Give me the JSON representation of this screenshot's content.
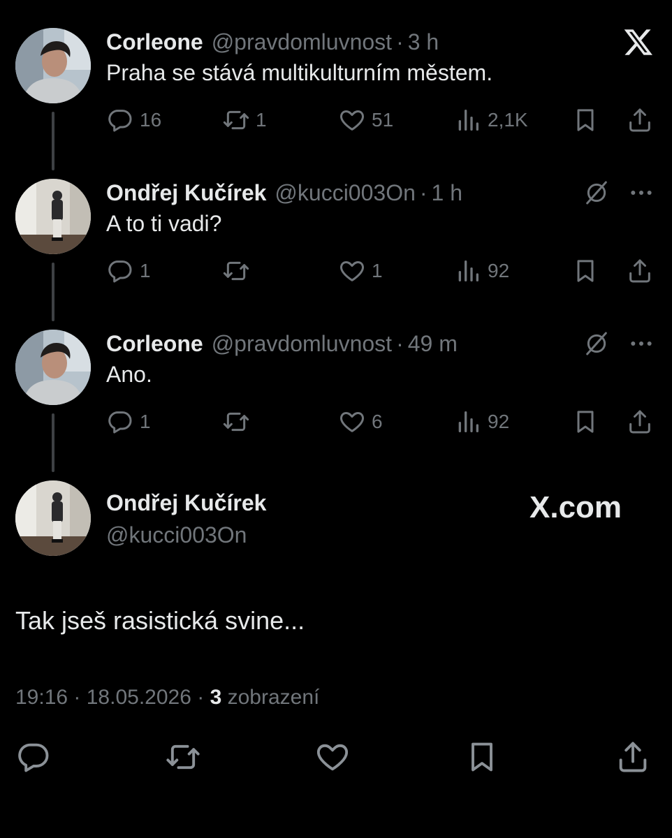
{
  "tweets": [
    {
      "name": "Corleone",
      "handle": "@pravdomluvnost",
      "dot": "·",
      "time": "3 h",
      "text": "Praha se stává multikulturním městem.",
      "replies": "16",
      "reposts": "1",
      "likes": "51",
      "views": "2,1K"
    },
    {
      "name": "Ondřej Kučírek",
      "handle": "@kucci003On",
      "dot": "·",
      "time": "1 h",
      "text": "A to ti vadi?",
      "replies": "1",
      "reposts": "",
      "likes": "1",
      "views": "92"
    },
    {
      "name": "Corleone",
      "handle": "@pravdomluvnost",
      "dot": "·",
      "time": "49 m",
      "text": "Ano.",
      "replies": "1",
      "reposts": "",
      "likes": "6",
      "views": "92"
    }
  ],
  "main": {
    "name": "Ondřej Kučírek",
    "handle": "@kucci003On",
    "brand": "X.com",
    "text": "Tak jseš rasistická svine...",
    "time": "19:16",
    "sep1": " · ",
    "date": "18.05.2026",
    "sep2": " · ",
    "views_count": "3",
    "views_label": " zobrazení"
  },
  "icons": {
    "reply": "reply-icon",
    "repost": "repost-icon",
    "like": "heart-icon",
    "views": "views-icon",
    "bookmark": "bookmark-icon",
    "share": "share-icon",
    "x_logo": "x-logo-icon",
    "grok": "grok-icon",
    "more": "more-icon"
  },
  "colors": {
    "background": "#000000",
    "text": "#e7e9ea",
    "muted": "#71767b",
    "thread_line": "#3e4144"
  }
}
